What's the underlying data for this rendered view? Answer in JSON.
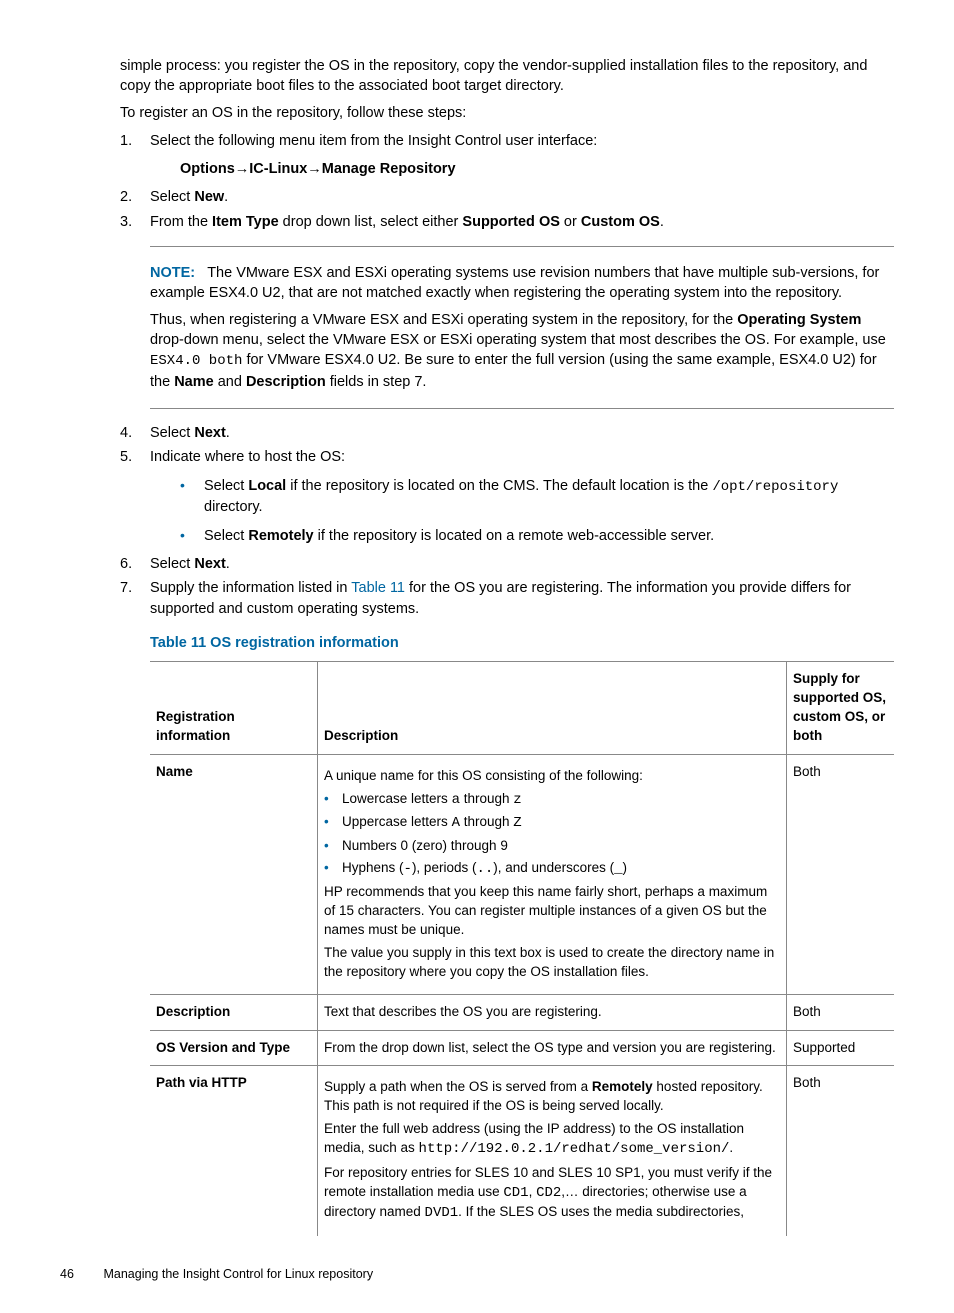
{
  "intro1": "simple process: you register the OS in the repository, copy the vendor-supplied installation files to the repository, and copy the appropriate boot files to the associated boot target directory.",
  "intro2": "To register an OS in the repository, follow these steps:",
  "steps": {
    "s1": {
      "num": "1.",
      "text": "Select the following menu item from the Insight Control user interface:"
    },
    "s1menu": "Options→IC-Linux→Manage Repository",
    "s2": {
      "num": "2.",
      "pre": "Select ",
      "b": "New",
      "post": "."
    },
    "s3": {
      "num": "3.",
      "text_a": "From the ",
      "b1": "Item Type",
      "text_b": " drop down list, select either ",
      "b2": "Supported OS",
      "text_c": " or ",
      "b3": "Custom OS",
      "text_d": "."
    },
    "s4": {
      "num": "4.",
      "pre": "Select ",
      "b": "Next",
      "post": "."
    },
    "s5": {
      "num": "5.",
      "text": "Indicate where to host the OS:"
    },
    "s5a": {
      "pre": "Select ",
      "b": "Local",
      "mid": " if the repository is located on the CMS. The default location is the ",
      "code1": "/opt/repository",
      "post": " directory."
    },
    "s5b": {
      "pre": "Select ",
      "b": "Remotely",
      "post": " if the repository is located on a remote web-accessible server."
    },
    "s6": {
      "num": "6.",
      "pre": "Select ",
      "b": "Next",
      "post": "."
    },
    "s7": {
      "num": "7.",
      "pre": "Supply the information listed in ",
      "link": "Table 11",
      "post": " for the OS you are registering. The information you provide differs for supported and custom operating systems."
    }
  },
  "note": {
    "label": "NOTE:",
    "p1": "The VMware ESX and ESXi operating systems use revision numbers that have multiple sub-versions, for example ESX4.0 U2, that are not matched exactly when registering the operating system into the repository.",
    "p2a": "Thus, when registering a VMware ESX and ESXi operating system in the repository, for the ",
    "p2b": "Operating System",
    "p2c": " drop-down menu, select the VMware ESX or ESXi operating system that most describes the OS. For example, use ",
    "p2code": "ESX4.0 both",
    "p2d": " for VMware ESX4.0 U2. Be sure to enter the full version (using the same example, ESX4.0 U2) for the ",
    "p2e": "Name",
    "p2f": " and ",
    "p2g": "Description",
    "p2h": " fields in step 7."
  },
  "table": {
    "title": "Table 11 OS registration information",
    "headers": {
      "h1": "Registration information",
      "h2": "Description",
      "h3": "Supply for supported OS, custom OS, or both"
    },
    "rows": {
      "name": {
        "label": "Name",
        "p1": "A unique name for this OS consisting of the following:",
        "b1a": "Lowercase letters ",
        "b1c1": "a",
        "b1b": " through ",
        "b1c2": "z",
        "b2a": "Uppercase letters ",
        "b2c1": "A",
        "b2b": " through ",
        "b2c2": "Z",
        "b3": "Numbers 0 (zero) through 9",
        "b4a": "Hyphens (",
        "b4c1": "-",
        "b4b": "), periods (",
        "b4c2": "..",
        "b4c": "), and underscores (",
        "b4c3": "_",
        "b4d": ")",
        "p2": "HP recommends that you keep this name fairly short, perhaps a maximum of 15 characters. You can register multiple instances of a given OS but the names must be unique.",
        "p3": "The value you supply in this text box is used to create the directory name in the repository where you copy the OS installation files.",
        "supply": "Both"
      },
      "desc": {
        "label": "Description",
        "p1": "Text that describes the OS you are registering.",
        "supply": "Both"
      },
      "osver": {
        "label": "OS Version and Type",
        "p1": "From the drop down list, select the OS type and version you are registering.",
        "supply": "Supported"
      },
      "path": {
        "label": "Path via HTTP",
        "p1a": "Supply a path when the OS is served from a ",
        "p1b": "Remotely",
        "p1c": " hosted repository. This path is not required if the OS is being served locally.",
        "p2a": "Enter the full web address (using the IP address) to the OS installation media, such as ",
        "p2code": "http://192.0.2.1/redhat/some_version/",
        "p2b": ".",
        "p3a": "For repository entries for SLES 10 and SLES 10 SP1, you must verify if the remote installation media use ",
        "p3c1": "CD1",
        "p3b": ", ",
        "p3c2": "CD2",
        "p3c": ",… directories; otherwise use a directory named ",
        "p3c3": "DVD1",
        "p3d": ". If the SLES OS uses the media subdirectories,",
        "supply": "Both"
      }
    }
  },
  "footer": {
    "page": "46",
    "text": "Managing the Insight Control for Linux repository"
  }
}
